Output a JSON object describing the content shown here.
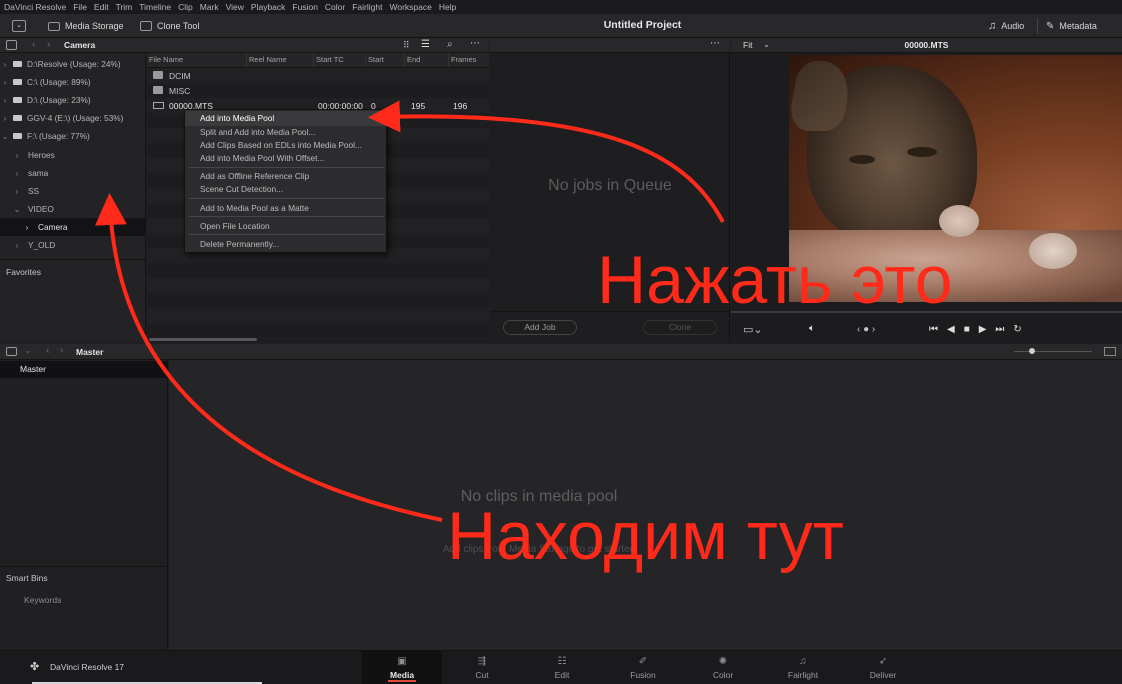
{
  "menu": [
    "DaVinci Resolve",
    "File",
    "Edit",
    "Trim",
    "Timeline",
    "Clip",
    "Mark",
    "View",
    "Playback",
    "Fusion",
    "Color",
    "Fairlight",
    "Workspace",
    "Help"
  ],
  "toolbar": {
    "media_storage": "Media Storage",
    "clone_tool": "Clone Tool",
    "project_title": "Untitled Project",
    "audio": "Audio",
    "metadata": "Metadata"
  },
  "storage": {
    "breadcrumb": "Camera",
    "drives": [
      {
        "label": "D:\\Resolve (Usage: 24%)"
      },
      {
        "label": "C:\\ (Usage: 89%)"
      },
      {
        "label": "D:\\ (Usage: 23%)"
      },
      {
        "label": "GGV-4 (E:\\) (Usage: 53%)"
      },
      {
        "label": "F:\\ (Usage: 77%)"
      }
    ],
    "folders": [
      "Heroes",
      "sama",
      "SS",
      "VIDEO",
      "Camera",
      "Y_OLD"
    ],
    "favorites": "Favorites"
  },
  "file_list": {
    "columns": [
      "File Name",
      "Reel Name",
      "Start TC",
      "Start",
      "End",
      "Frames"
    ],
    "rows": [
      {
        "name": "DCIM"
      },
      {
        "name": "MISC"
      },
      {
        "name": "00000.MTS",
        "start_tc": "00:00:00:00",
        "start": "0",
        "end": "195",
        "frames": "196"
      }
    ]
  },
  "context_menu": [
    "Add into Media Pool",
    "Split and Add into Media Pool...",
    "Add Clips Based on EDLs into Media Pool...",
    "Add into Media Pool With Offset...",
    "Add as Offline Reference Clip",
    "Scene Cut Detection...",
    "Add to Media Pool as a Matte",
    "Open File Location",
    "Delete Permanently..."
  ],
  "render_queue": {
    "empty": "No jobs in Queue",
    "add_job": "Add Job",
    "clone": "Clone"
  },
  "viewer": {
    "fit": "Fit",
    "clip_name": "00000.MTS"
  },
  "pool": {
    "breadcrumb": "Master",
    "master": "Master",
    "smart_bins": "Smart Bins",
    "keywords": "Keywords",
    "empty": "No clips in media pool",
    "hint": "Add clips from Media Storage to get started"
  },
  "pages": [
    "Media",
    "Cut",
    "Edit",
    "Fusion",
    "Color",
    "Fairlight",
    "Deliver"
  ],
  "app_name": "DaVinci Resolve 17",
  "annotations": {
    "press_this": "Нажать это",
    "find_here": "Находим тут"
  },
  "colors": {
    "accent": "#e04a3a",
    "annotation": "#ff2a1a"
  }
}
